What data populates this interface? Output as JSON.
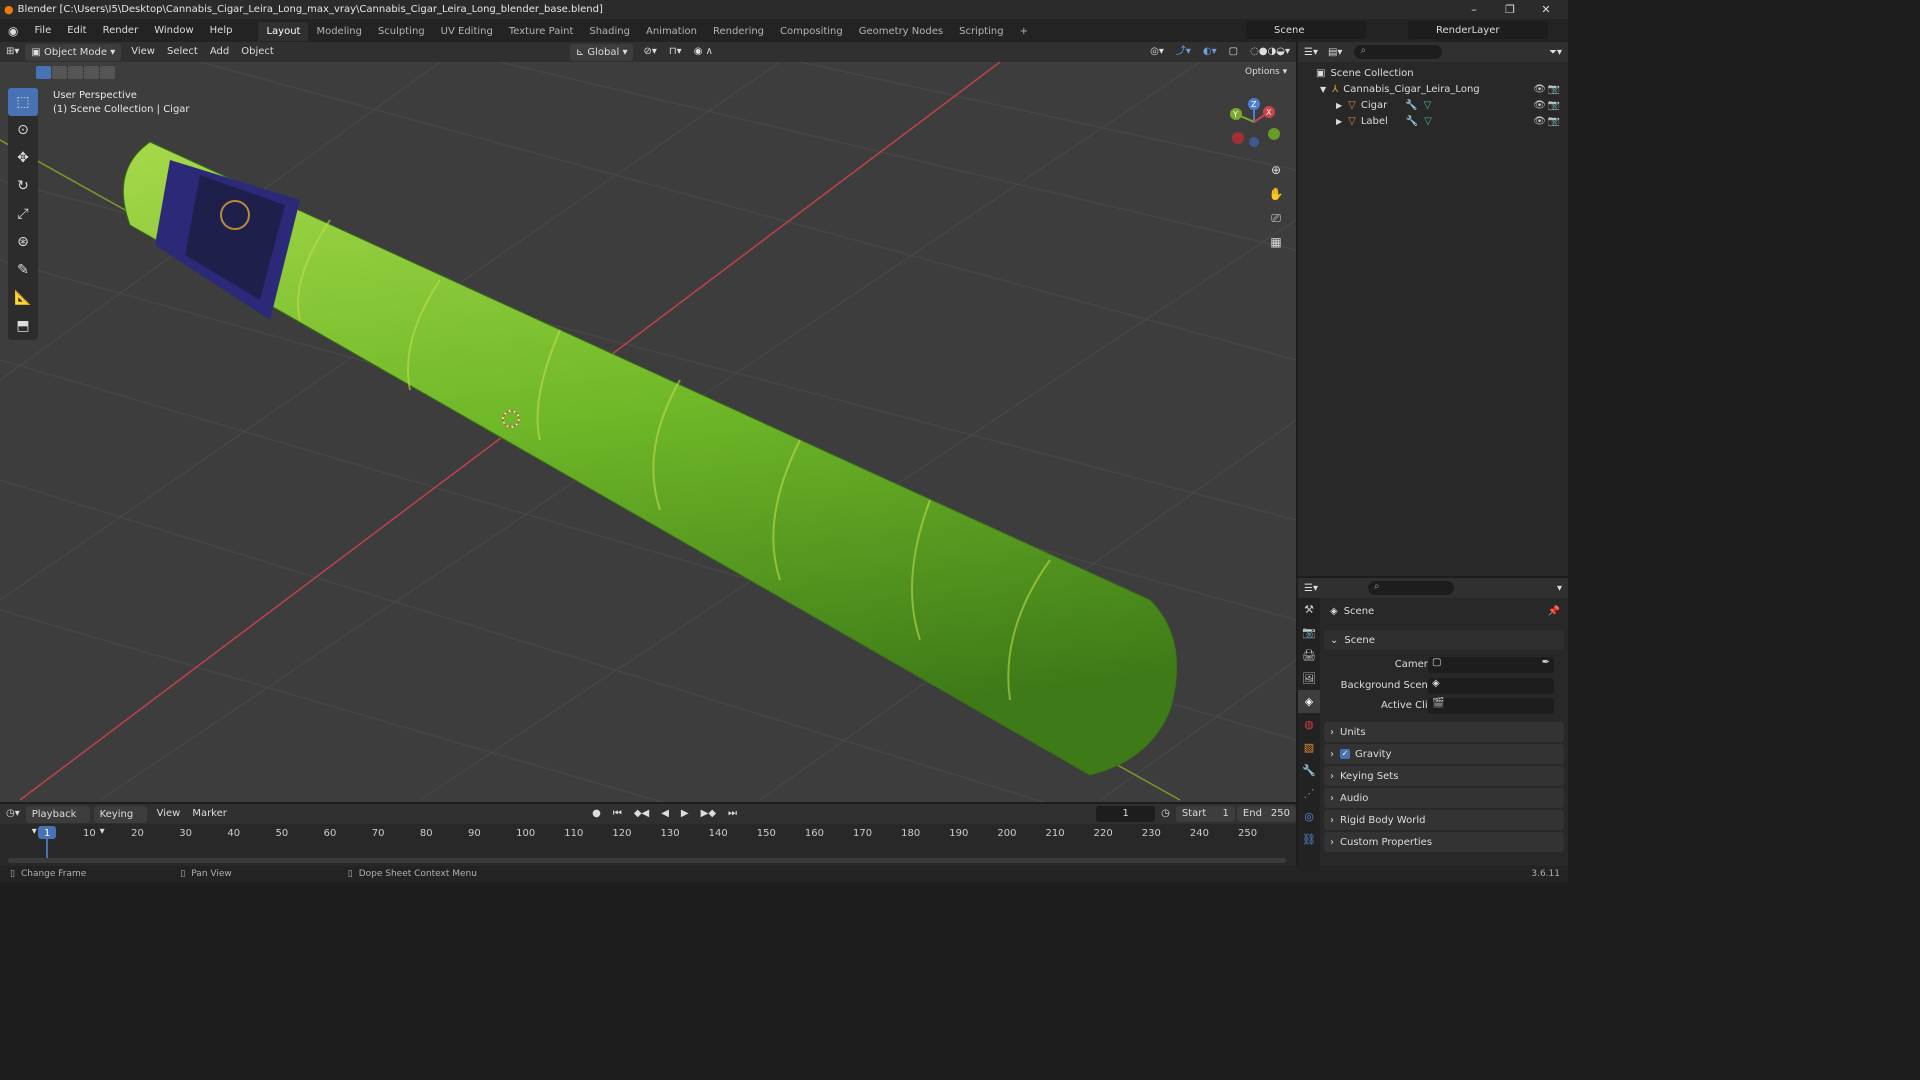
{
  "window": {
    "title": "Blender [C:\\Users\\I5\\Desktop\\Cannabis_Cigar_Leira_Long_max_vray\\Cannabis_Cigar_Leira_Long_blender_base.blend]"
  },
  "menu": {
    "items": [
      "File",
      "Edit",
      "Render",
      "Window",
      "Help"
    ]
  },
  "workspaces": [
    "Layout",
    "Modeling",
    "Sculpting",
    "UV Editing",
    "Texture Paint",
    "Shading",
    "Animation",
    "Rendering",
    "Compositing",
    "Geometry Nodes",
    "Scripting"
  ],
  "topright": {
    "scene": "Scene",
    "render_layer": "RenderLayer"
  },
  "viewport_header": {
    "mode": "Object Mode",
    "view": "View",
    "select": "Select",
    "add": "Add",
    "object": "Object",
    "orientation": "Global",
    "options": "Options"
  },
  "viewport": {
    "perspective": "User Perspective",
    "collection": "(1) Scene Collection | Cigar"
  },
  "gizmo": {
    "x": "X",
    "y": "Y",
    "z": "Z"
  },
  "outliner": {
    "root": "Scene Collection",
    "collection": "Cannabis_Cigar_Leira_Long",
    "objects": [
      "Cigar",
      "Label"
    ]
  },
  "properties": {
    "title": "Scene",
    "section": "Scene",
    "camera_label": "Camera",
    "background_label": "Background Scene",
    "clip_label": "Active Clip",
    "panels": [
      "Units",
      "Gravity",
      "Keying Sets",
      "Audio",
      "Rigid Body World",
      "Custom Properties"
    ]
  },
  "timeline": {
    "playback": "Playback",
    "keying": "Keying",
    "view": "View",
    "marker": "Marker",
    "current_frame": "1",
    "start_label": "Start",
    "start": "1",
    "end_label": "End",
    "end": "250",
    "ticks": [
      "1",
      "10",
      "20",
      "30",
      "40",
      "50",
      "60",
      "70",
      "80",
      "90",
      "100",
      "110",
      "120",
      "130",
      "140",
      "150",
      "160",
      "170",
      "180",
      "190",
      "200",
      "210",
      "220",
      "230",
      "240",
      "250"
    ]
  },
  "status": {
    "change_frame": "Change Frame",
    "pan_view": "Pan View",
    "context_menu": "Dope Sheet Context Menu",
    "version": "3.6.11"
  },
  "colors": {
    "accent": "#4772b3",
    "cigar": "#7fc234",
    "axis_red": "#c0424a",
    "axis_green": "#7a9a2a"
  }
}
